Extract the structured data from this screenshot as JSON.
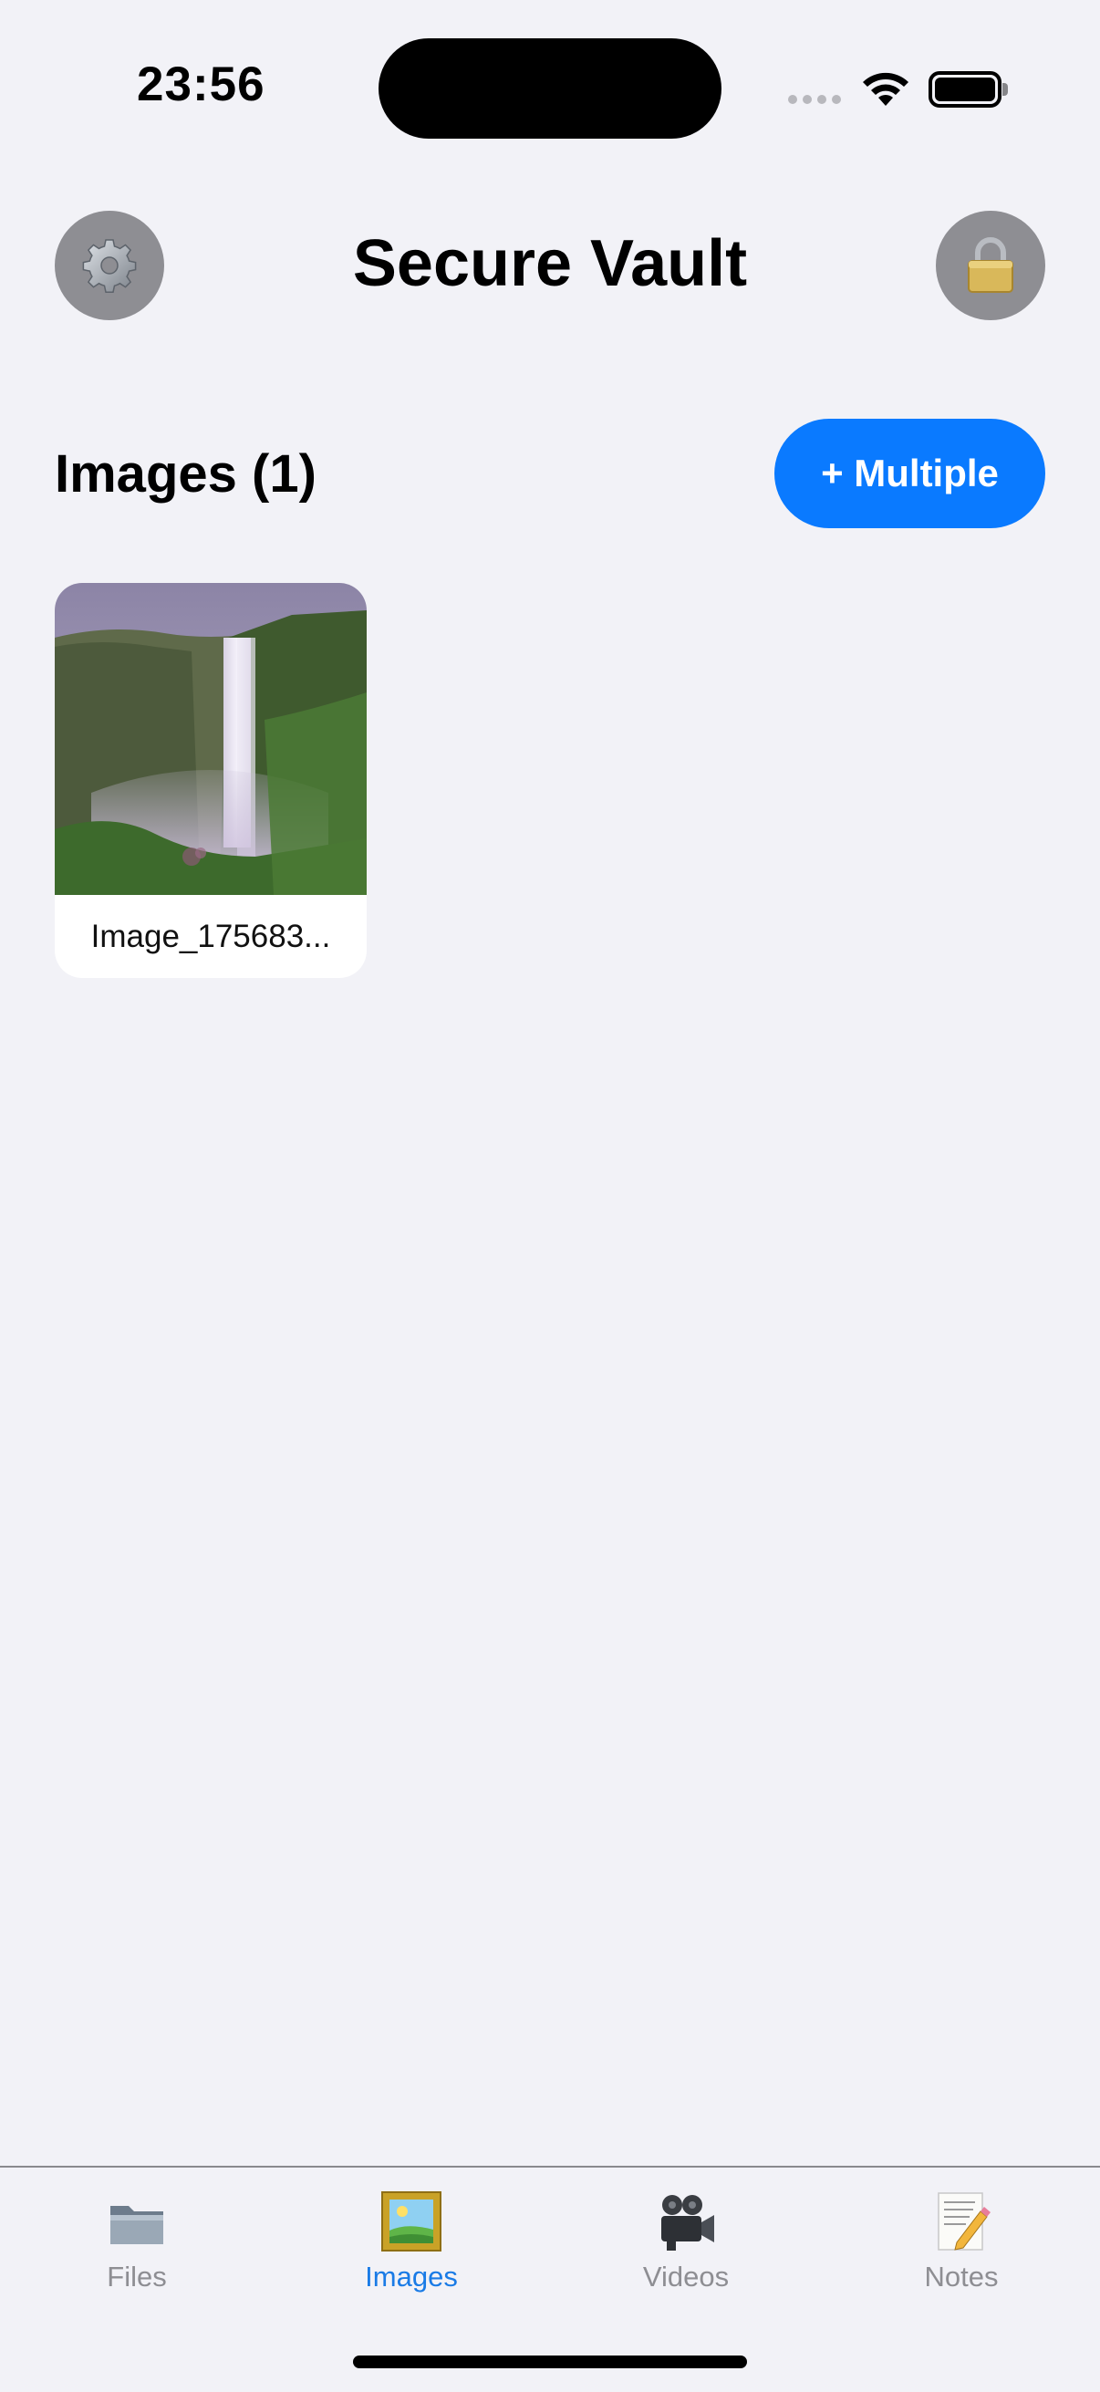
{
  "status_bar": {
    "time": "23:56",
    "icons": [
      "cellular-signal-icon",
      "wifi-icon",
      "battery-icon"
    ]
  },
  "header": {
    "title": "Secure Vault",
    "left_icon": "gear-icon",
    "right_icon": "padlock-icon"
  },
  "section": {
    "title": "Images (1)",
    "add_button_label": "+ Multiple"
  },
  "images": [
    {
      "name": "Image_175683...",
      "thumbnail": "waterfall-photo"
    }
  ],
  "tabs": [
    {
      "label": "Files",
      "icon": "folder-icon",
      "active": false
    },
    {
      "label": "Images",
      "icon": "framed-picture-icon",
      "active": true
    },
    {
      "label": "Videos",
      "icon": "movie-camera-icon",
      "active": false
    },
    {
      "label": "Notes",
      "icon": "memo-icon",
      "active": false
    }
  ],
  "colors": {
    "background": "#f2f2f7",
    "accent": "#0a7aff",
    "active_tab": "#1a7be6",
    "inactive": "#8e8e93",
    "circle_button": "#8e8e93"
  }
}
